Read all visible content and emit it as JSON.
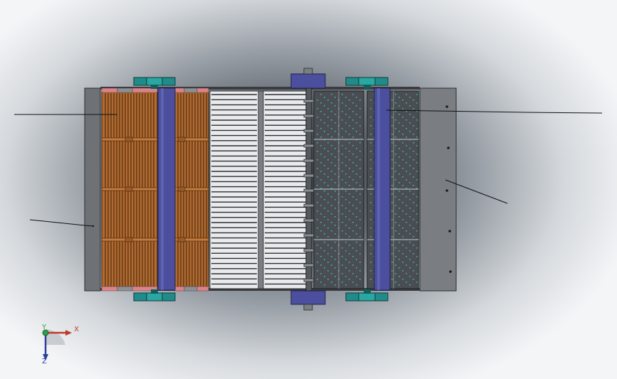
{
  "view": {
    "background": "#d6dadd",
    "frame_color": "#6e7276",
    "shaft_color": "#4b4f9e",
    "wood_color": "#b26a2e",
    "bearing_color": "#1f8c8a",
    "screen_dot_color": "#3bb8b0"
  },
  "triad": {
    "x_label": "X",
    "y_label": "Y",
    "z_label": "Z",
    "x_color": "#c0392b",
    "y_color": "#2e9e4a",
    "z_color": "#2c3e9e"
  }
}
